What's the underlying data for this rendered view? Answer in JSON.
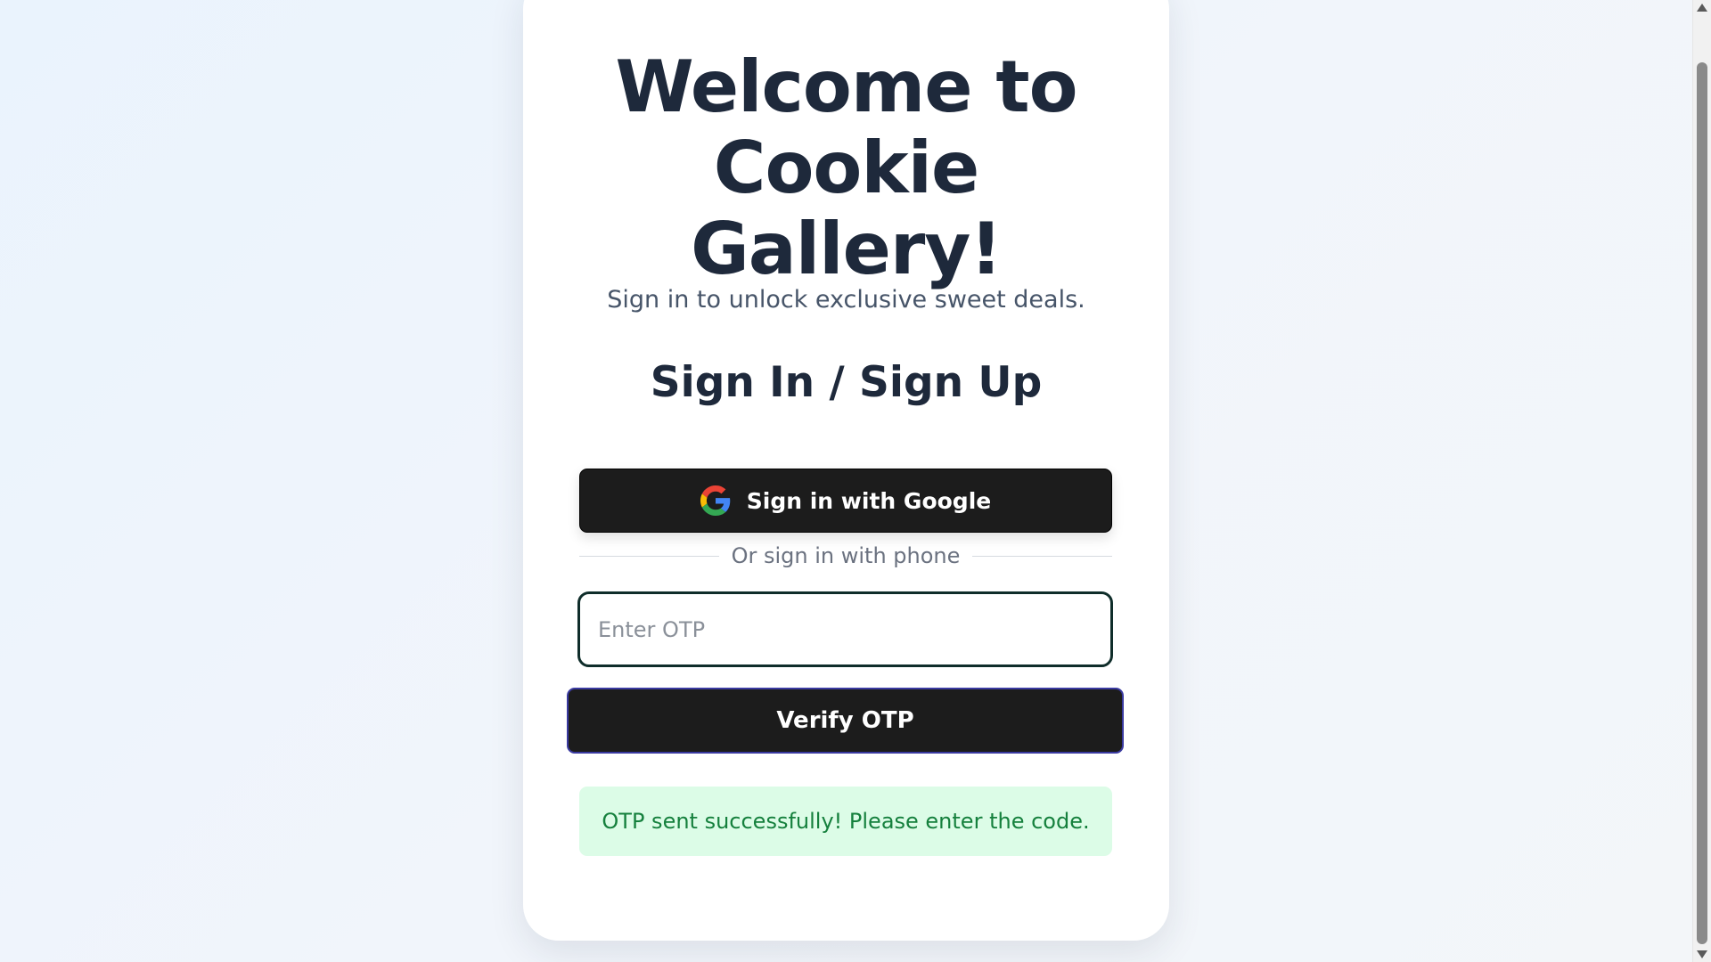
{
  "header": {
    "title_lines": [
      "Welcome to",
      "Cookie",
      "Gallery!"
    ],
    "subtitle": "Sign in to unlock exclusive sweet deals."
  },
  "auth": {
    "section_title": "Sign In / Sign Up",
    "google_button_label": "Sign in with Google",
    "google_icon": "google-g-icon",
    "divider_text": "Or sign in with phone",
    "otp_input": {
      "value": "",
      "placeholder": "Enter OTP"
    },
    "verify_button_label": "Verify OTP",
    "status_message": "OTP sent successfully! Please enter the code."
  },
  "colors": {
    "heading": "#1e293b",
    "button_bg": "#1c1c1c",
    "success_bg": "#dcfce7",
    "success_text": "#15803d"
  }
}
